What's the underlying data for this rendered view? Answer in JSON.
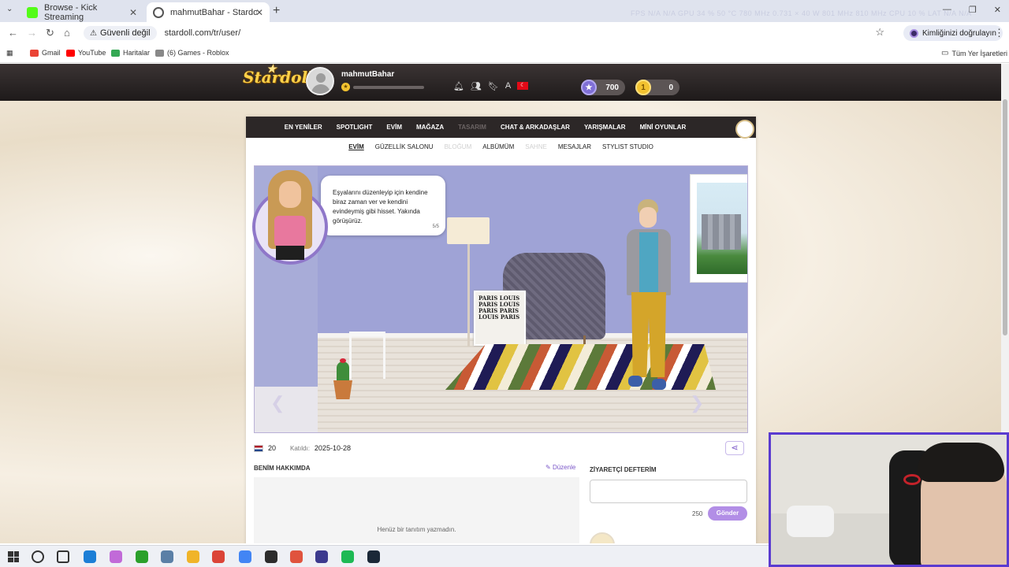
{
  "browser": {
    "tabs": [
      {
        "title": "Browse - Kick Streaming",
        "favicon_color": "#53fc18"
      },
      {
        "title": "mahmutBahar - Stardoll | Türkçe",
        "favicon_color": "#555555"
      }
    ],
    "overlay_stats": "FPS N/A N/A   GPU 34 % 50 °C 780 MHz 0.731 × 40 W 801 MHz 810 MHz   CPU 10 %   LAT N/A N/A",
    "security_label": "Güvenli değil",
    "url": "stardoll.com/tr/user/",
    "profile_label": "Kimliğinizi doğrulayın",
    "bookmarks": [
      {
        "label": "Gmail",
        "color": "#ea4335"
      },
      {
        "label": "YouTube",
        "color": "#ff0000"
      },
      {
        "label": "Haritalar",
        "color": "#34a853"
      },
      {
        "label": "(6) Games - Roblox",
        "color": "#888888"
      }
    ],
    "all_bookmarks_label": "Tüm Yer İşaretleri"
  },
  "header": {
    "logo": "Stardoll",
    "username": "mahmutBahar",
    "xp_progress": 0,
    "stardollars": "700",
    "coins": "0"
  },
  "main_nav": [
    {
      "label": "EN YENİLER",
      "dim": false
    },
    {
      "label": "SPOTLIGHT",
      "dim": false
    },
    {
      "label": "EVİM",
      "dim": false
    },
    {
      "label": "MAĞAZA",
      "dim": false
    },
    {
      "label": "TASARIM",
      "dim": true
    },
    {
      "label": "CHAT & ARKADAŞLAR",
      "dim": false
    },
    {
      "label": "YARIŞMALAR",
      "dim": false
    },
    {
      "label": "MİNİ OYUNLAR",
      "dim": false
    }
  ],
  "sub_nav": [
    {
      "label": "EVİM",
      "state": "active"
    },
    {
      "label": "GÜZELLİK SALONU",
      "state": ""
    },
    {
      "label": "BLOĞUM",
      "state": "dim"
    },
    {
      "label": "ALBÜMÜM",
      "state": ""
    },
    {
      "label": "SAHNE",
      "state": "dim"
    },
    {
      "label": "MESAJLAR",
      "state": ""
    },
    {
      "label": "STYLIST STUDIO",
      "state": ""
    }
  ],
  "tutorial": {
    "text": "Eşyalarını düzenleyip için kendine biraz zaman ver ve kendini evindeymiş gibi hisset. Yakında görüşürüz.",
    "page": "5/5"
  },
  "room": {
    "poster_text": "PARIS LOUIS PARIS LOUIS PARIS PARIS LOUIS PARIS"
  },
  "profile": {
    "level": "20",
    "joined_label": "Katıldı:",
    "joined_date": "2025-10-28",
    "about_title": "BENİM HAKKIMDA",
    "edit_label": "Düzenle",
    "about_empty": "Henüz bir tanıtım yazmadın.",
    "guestbook_title": "ZİYARETÇİ DEFTERİM",
    "char_limit": "250",
    "send_label": "Gönder"
  },
  "taskbar_apps": [
    {
      "name": "search",
      "color": "#333333"
    },
    {
      "name": "task-view",
      "color": "#333333"
    },
    {
      "name": "edge",
      "color": "#1c7ed6"
    },
    {
      "name": "copilot",
      "color": "#c16ad8"
    },
    {
      "name": "kick",
      "color": "#2ba02b"
    },
    {
      "name": "desktop",
      "color": "#5b7fa6"
    },
    {
      "name": "explorer",
      "color": "#f0b429"
    },
    {
      "name": "chrome",
      "color": "#db4437"
    },
    {
      "name": "chrome-profile",
      "color": "#4285f4"
    },
    {
      "name": "app-dark",
      "color": "#2c2c2c"
    },
    {
      "name": "app-red",
      "color": "#e0533d"
    },
    {
      "name": "obs",
      "color": "#3c3a8e"
    },
    {
      "name": "spotify",
      "color": "#1db954"
    },
    {
      "name": "steam",
      "color": "#1b2838"
    }
  ]
}
